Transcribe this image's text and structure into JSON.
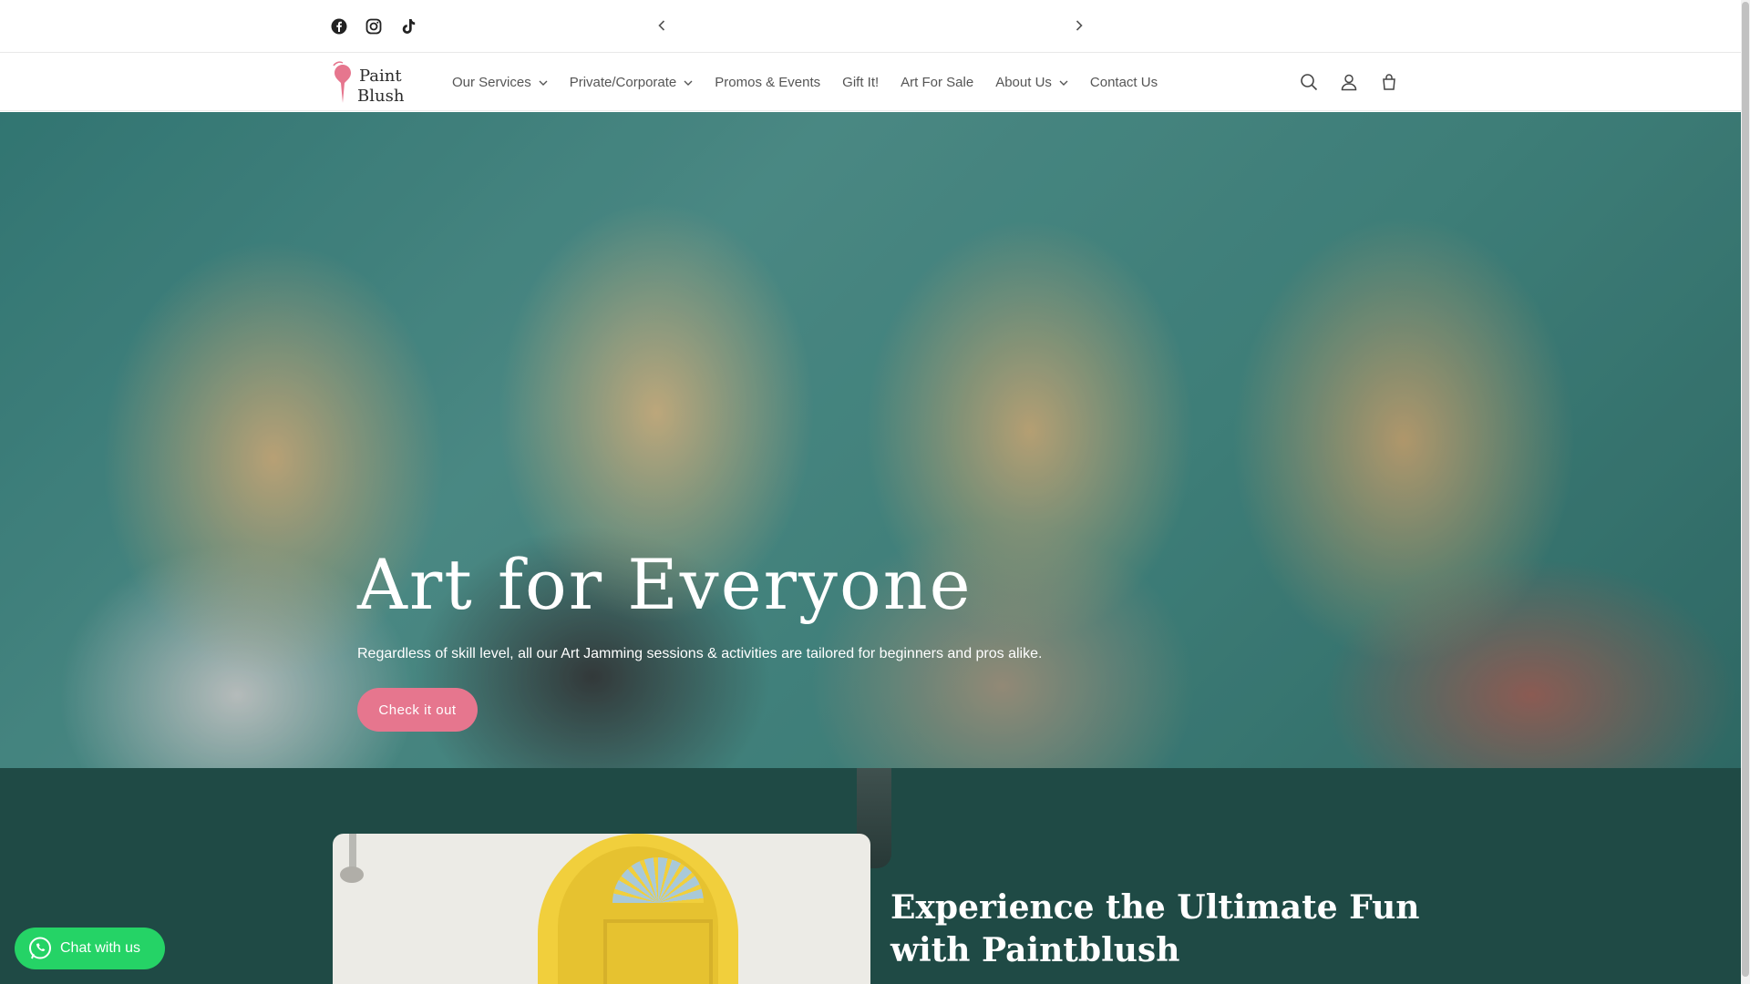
{
  "announcement": {
    "social": [
      "facebook-icon",
      "instagram-icon",
      "tiktok-icon"
    ],
    "prev_icon": "chevron-left-icon",
    "next_icon": "chevron-right-icon"
  },
  "header": {
    "logo_text_line1": "Paint",
    "logo_text_line2": "Blush",
    "nav": [
      {
        "label": "Our Services",
        "dropdown": true
      },
      {
        "label": "Private/Corporate",
        "dropdown": true
      },
      {
        "label": "Promos & Events",
        "dropdown": false
      },
      {
        "label": "Gift It!",
        "dropdown": false
      },
      {
        "label": "Art For Sale",
        "dropdown": false
      },
      {
        "label": "About Us",
        "dropdown": true
      },
      {
        "label": "Contact Us",
        "dropdown": false
      }
    ],
    "icons": [
      "search-icon",
      "account-icon",
      "cart-icon"
    ]
  },
  "hero": {
    "title": "Art for Everyone",
    "subtitle": "Regardless of skill level, all our Art Jamming sessions & activities are tailored for beginners and pros alike.",
    "button": "Check it out"
  },
  "feature": {
    "title": "Experience the Ultimate Fun with Paintblush"
  },
  "chat": {
    "label": "Chat with us"
  },
  "colors": {
    "accent_pink": "#e6768e",
    "dark_teal": "#1f4a45",
    "whatsapp_green": "#25d366"
  }
}
